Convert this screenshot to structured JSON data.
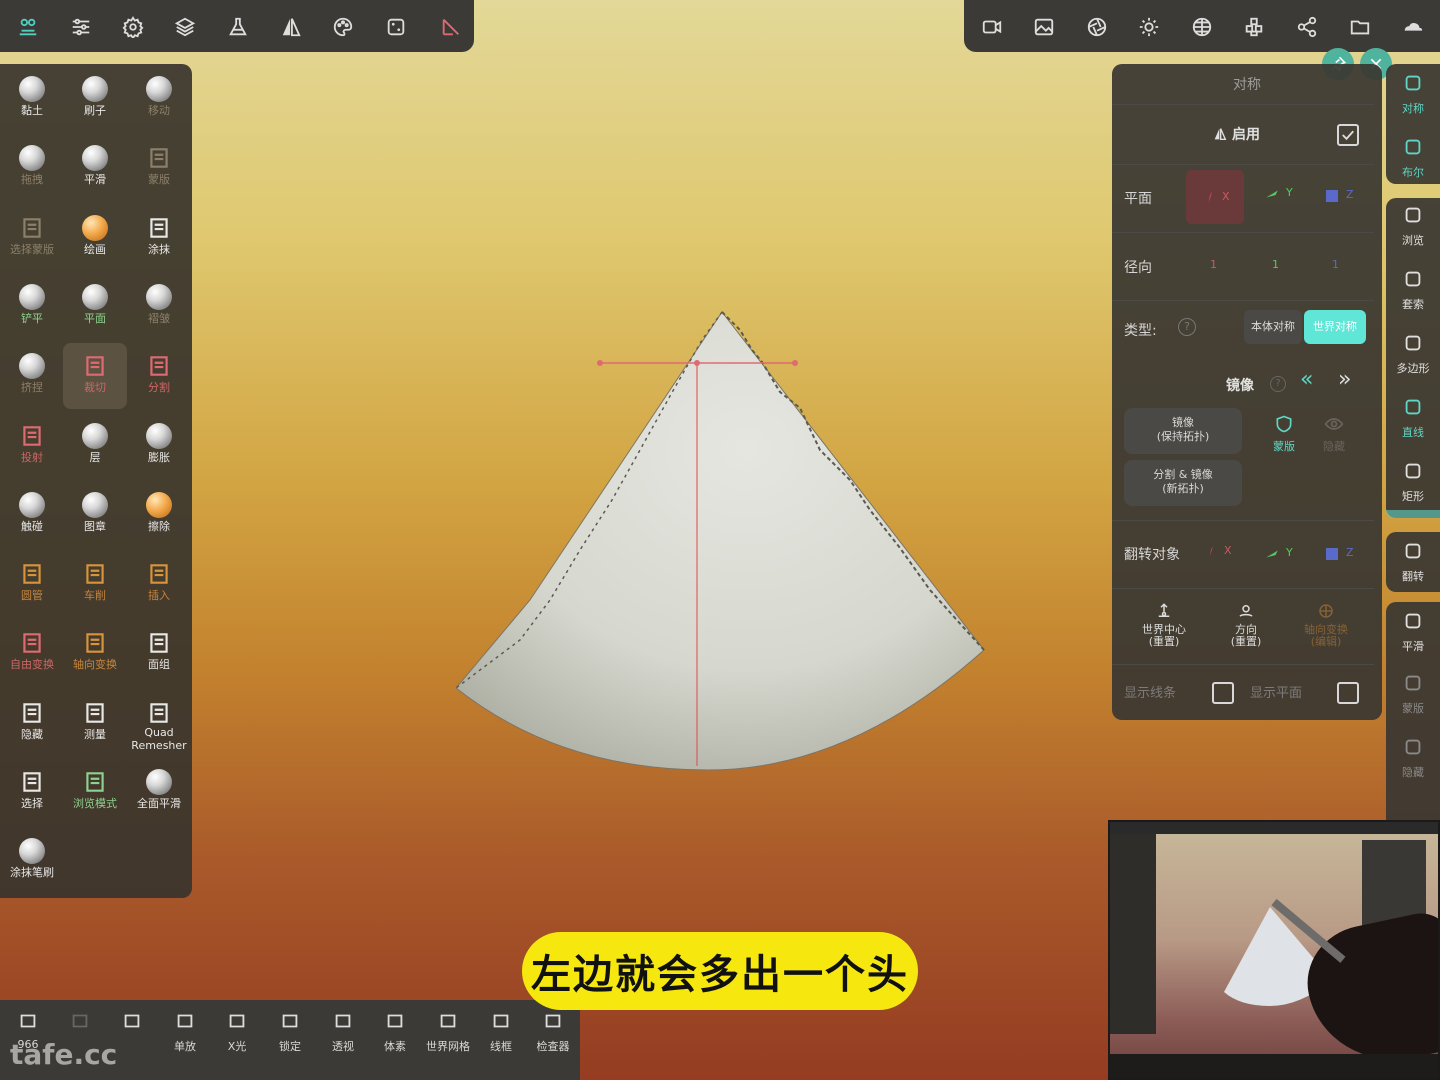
{
  "top_left_toolbar": {
    "icons": [
      "sculpt-tools-icon",
      "sliders-icon",
      "settings-icon",
      "layers-icon",
      "flask-icon",
      "symmetry-icon",
      "palette-icon",
      "dice-icon",
      "trim-tool-icon"
    ]
  },
  "top_right_toolbar": {
    "icons": [
      "video-icon",
      "image-icon",
      "aperture-icon",
      "sun-icon",
      "globe-grid-icon",
      "voxels-icon",
      "share-icon",
      "folder-icon",
      "cloud-icon"
    ]
  },
  "tools": [
    {
      "label": "黏土",
      "style": "white",
      "icon": "sphere"
    },
    {
      "label": "刷子",
      "style": "white",
      "icon": "sphere"
    },
    {
      "label": "移动",
      "style": "dim",
      "icon": "sphere"
    },
    {
      "label": "拖拽",
      "style": "dim",
      "icon": "sphere"
    },
    {
      "label": "平滑",
      "style": "white",
      "icon": "sphere"
    },
    {
      "label": "蒙版",
      "style": "dim",
      "icon": "shield"
    },
    {
      "label": "选择蒙版",
      "style": "dim",
      "icon": "shield"
    },
    {
      "label": "绘画",
      "style": "white",
      "icon": "sphere-orange"
    },
    {
      "label": "涂抹",
      "style": "white",
      "icon": "smudge"
    },
    {
      "label": "铲平",
      "style": "green",
      "icon": "sphere"
    },
    {
      "label": "平面",
      "style": "green",
      "icon": "sphere"
    },
    {
      "label": "褶皱",
      "style": "dim",
      "icon": "sphere"
    },
    {
      "label": "挤捏",
      "style": "dim",
      "icon": "sphere"
    },
    {
      "label": "裁切",
      "style": "red",
      "icon": "trim",
      "selected": true
    },
    {
      "label": "分割",
      "style": "red",
      "icon": "split"
    },
    {
      "label": "投射",
      "style": "red",
      "icon": "project"
    },
    {
      "label": "层",
      "style": "white",
      "icon": "sphere"
    },
    {
      "label": "膨胀",
      "style": "white",
      "icon": "sphere"
    },
    {
      "label": "触碰",
      "style": "white",
      "icon": "sphere"
    },
    {
      "label": "图章",
      "style": "white",
      "icon": "sphere"
    },
    {
      "label": "擦除",
      "style": "white",
      "icon": "sphere-orange"
    },
    {
      "label": "圆管",
      "style": "orange",
      "icon": "tube"
    },
    {
      "label": "车削",
      "style": "orange",
      "icon": "lathe"
    },
    {
      "label": "插入",
      "style": "orange",
      "icon": "insert"
    },
    {
      "label": "自由变换",
      "style": "red",
      "icon": "transform"
    },
    {
      "label": "轴向变换",
      "style": "orange",
      "icon": "gizmo"
    },
    {
      "label": "面组",
      "style": "white",
      "icon": "facegroup"
    },
    {
      "label": "隐藏",
      "style": "white",
      "icon": "hide"
    },
    {
      "label": "测量",
      "style": "white",
      "icon": "ruler"
    },
    {
      "label": "Quad Remesher",
      "style": "white",
      "icon": "grid"
    },
    {
      "label": "选择",
      "style": "white",
      "icon": "select"
    },
    {
      "label": "浏览模式",
      "style": "green",
      "icon": "camera"
    },
    {
      "label": "全面平滑",
      "style": "white",
      "icon": "sphere"
    },
    {
      "label": "涂抹笔刷",
      "style": "white",
      "icon": "sphere"
    }
  ],
  "symmetry": {
    "title": "对称",
    "enable_label": "启用",
    "enabled": true,
    "plane_label": "平面",
    "plane_axes": [
      "X",
      "Y",
      "Z"
    ],
    "radial_label": "径向",
    "radial_values": [
      "1",
      "1",
      "1"
    ],
    "type_label": "类型:",
    "type_options": [
      "本体对称",
      "世界对称"
    ],
    "type_selected": "世界对称",
    "mirror_label": "镜像",
    "mirror_keep_topo": "镜像\n(保持拓扑)",
    "mirror_mask": "蒙版",
    "mirror_hide": "隐藏",
    "split_mirror": "分割 & 镜像\n(新拓扑)",
    "flip_label": "翻转对象",
    "flip_axes": [
      "X",
      "Y",
      "Z"
    ],
    "world_center": "世界中心\n(重置)",
    "direction": "方向\n(重置)",
    "gizmo_transform": "轴向变换\n(编辑)",
    "show_lines": "显示线条",
    "show_plane": "显示平面"
  },
  "right_sidebar": [
    {
      "label": "对称",
      "icon": "symmetry-icon",
      "color": "#5fd6c6"
    },
    {
      "label": "布尔",
      "icon": "boolean-icon",
      "color": "#5fd6c6"
    },
    {
      "label": "浏览",
      "icon": "video-icon",
      "color": "#e0e0e0"
    },
    {
      "label": "套索",
      "icon": "lasso-icon",
      "color": "#e0e0e0"
    },
    {
      "label": "多边形",
      "icon": "polygon-icon",
      "color": "#e0e0e0"
    },
    {
      "label": "直线",
      "icon": "line-icon",
      "color": "#5fd6c6"
    },
    {
      "label": "矩形",
      "icon": "rectangle-icon",
      "color": "#e0e0e0"
    },
    {
      "label": "翻转",
      "icon": "flip-icon",
      "color": "#e0e0e0"
    },
    {
      "label": "平滑",
      "icon": "smooth-icon",
      "color": "#e0e0e0"
    },
    {
      "label": "蒙版",
      "icon": "mask-icon",
      "color": "#8a8a8a"
    },
    {
      "label": "隐藏",
      "icon": "hide-icon",
      "color": "#8a8a8a"
    }
  ],
  "bottom_bar": [
    {
      "label": "966",
      "icon": "undo-icon"
    },
    {
      "label": "",
      "icon": "redo-icon"
    },
    {
      "label": "",
      "icon": "document-icon"
    },
    {
      "label": "单放",
      "icon": "search-icon"
    },
    {
      "label": "X光",
      "icon": "xray-icon"
    },
    {
      "label": "锁定",
      "icon": "lock-icon"
    },
    {
      "label": "透视",
      "icon": "perspective-icon"
    },
    {
      "label": "体素",
      "icon": "voxel-icon"
    },
    {
      "label": "世界网格",
      "icon": "world-grid-icon"
    },
    {
      "label": "线框",
      "icon": "wireframe-icon"
    },
    {
      "label": "检查器",
      "icon": "inspector-icon"
    }
  ],
  "subtitle": "左边就会多出一个头",
  "watermark": "tafe.cc",
  "colors": {
    "accent": "#5fd6c6",
    "subtitle_bg": "#f6e80e",
    "trim_red": "#e06a72",
    "symmetry_line": "#e04848"
  }
}
